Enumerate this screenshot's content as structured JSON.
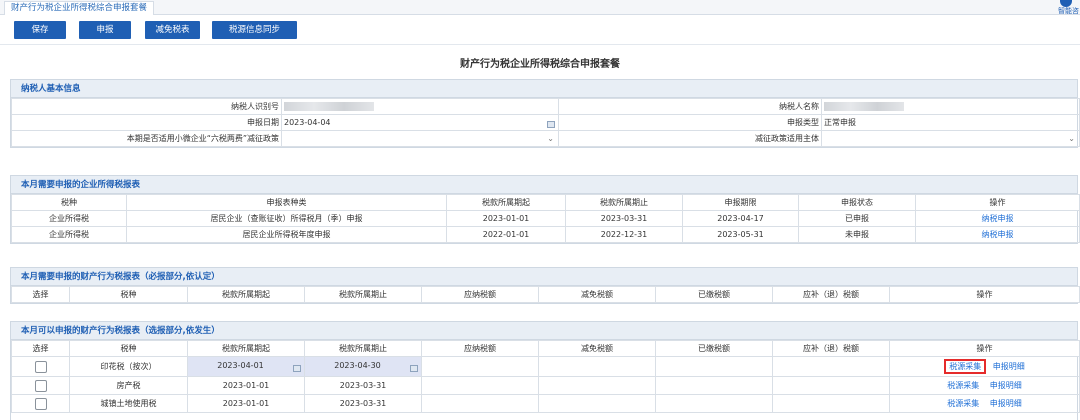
{
  "tab": {
    "label": "财产行为税企业所得税综合申报套餐"
  },
  "assistant": {
    "label": "智能咨"
  },
  "toolbar": {
    "save": "保存",
    "declare": "申报",
    "reduce": "减免税表",
    "sync": "税源信息同步"
  },
  "page_title": "财产行为税企业所得税综合申报套餐",
  "basic_info": {
    "title": "纳税人基本信息",
    "taxpayer_id_label": "纳税人识别号",
    "taxpayer_name_label": "纳税人名称",
    "declare_date_label": "申报日期",
    "declare_date_value": "2023-04-04",
    "declare_type_label": "申报类型",
    "declare_type_value": "正常申报",
    "policy_label": "本期是否适用小微企业“六税两费”减征政策",
    "policy_value": "",
    "subject_label": "减征政策适用主体",
    "subject_value": ""
  },
  "income_tax": {
    "title": "本月需要申报的企业所得税报表",
    "headers": [
      "税种",
      "申报表种类",
      "税款所属期起",
      "税款所属期止",
      "申报期限",
      "申报状态",
      "操作"
    ],
    "rows": [
      {
        "tax": "企业所得税",
        "form": "居民企业（查账征收）所得税月（季）申报",
        "start": "2023-01-01",
        "end": "2023-03-31",
        "deadline": "2023-04-17",
        "status": "已申报",
        "action": "纳税申报"
      },
      {
        "tax": "企业所得税",
        "form": "居民企业所得税年度申报",
        "start": "2022-01-01",
        "end": "2022-12-31",
        "deadline": "2023-05-31",
        "status": "未申报",
        "action": "纳税申报"
      }
    ]
  },
  "required": {
    "title": "本月需要申报的财产行为税报表（必报部分,依认定）",
    "headers": [
      "选择",
      "税种",
      "税款所属期起",
      "税款所属期止",
      "应纳税额",
      "减免税额",
      "已缴税额",
      "应补（退）税额",
      "操作"
    ]
  },
  "optional": {
    "title": "本月可以申报的财产行为税报表（选报部分,依发生）",
    "headers": [
      "选择",
      "税种",
      "税款所属期起",
      "税款所属期止",
      "应纳税额",
      "减免税额",
      "已缴税额",
      "应补（退）税额",
      "操作"
    ],
    "rows": [
      {
        "tax": "印花税（按次）",
        "start": "2023-04-01",
        "end": "2023-04-30",
        "action1": "税源采集",
        "action2": "申报明细"
      },
      {
        "tax": "房产税",
        "start": "2023-01-01",
        "end": "2023-03-31",
        "action1": "税源采集",
        "action2": "申报明细"
      },
      {
        "tax": "城镇土地使用税",
        "start": "2023-01-01",
        "end": "2023-03-31",
        "action1": "税源采集",
        "action2": "申报明细"
      }
    ]
  },
  "colors": {
    "accent": "#1f5fb4",
    "link": "#1f6fd6",
    "highlight": "#e52b2b",
    "section_head_bg": "#e8eef5"
  }
}
